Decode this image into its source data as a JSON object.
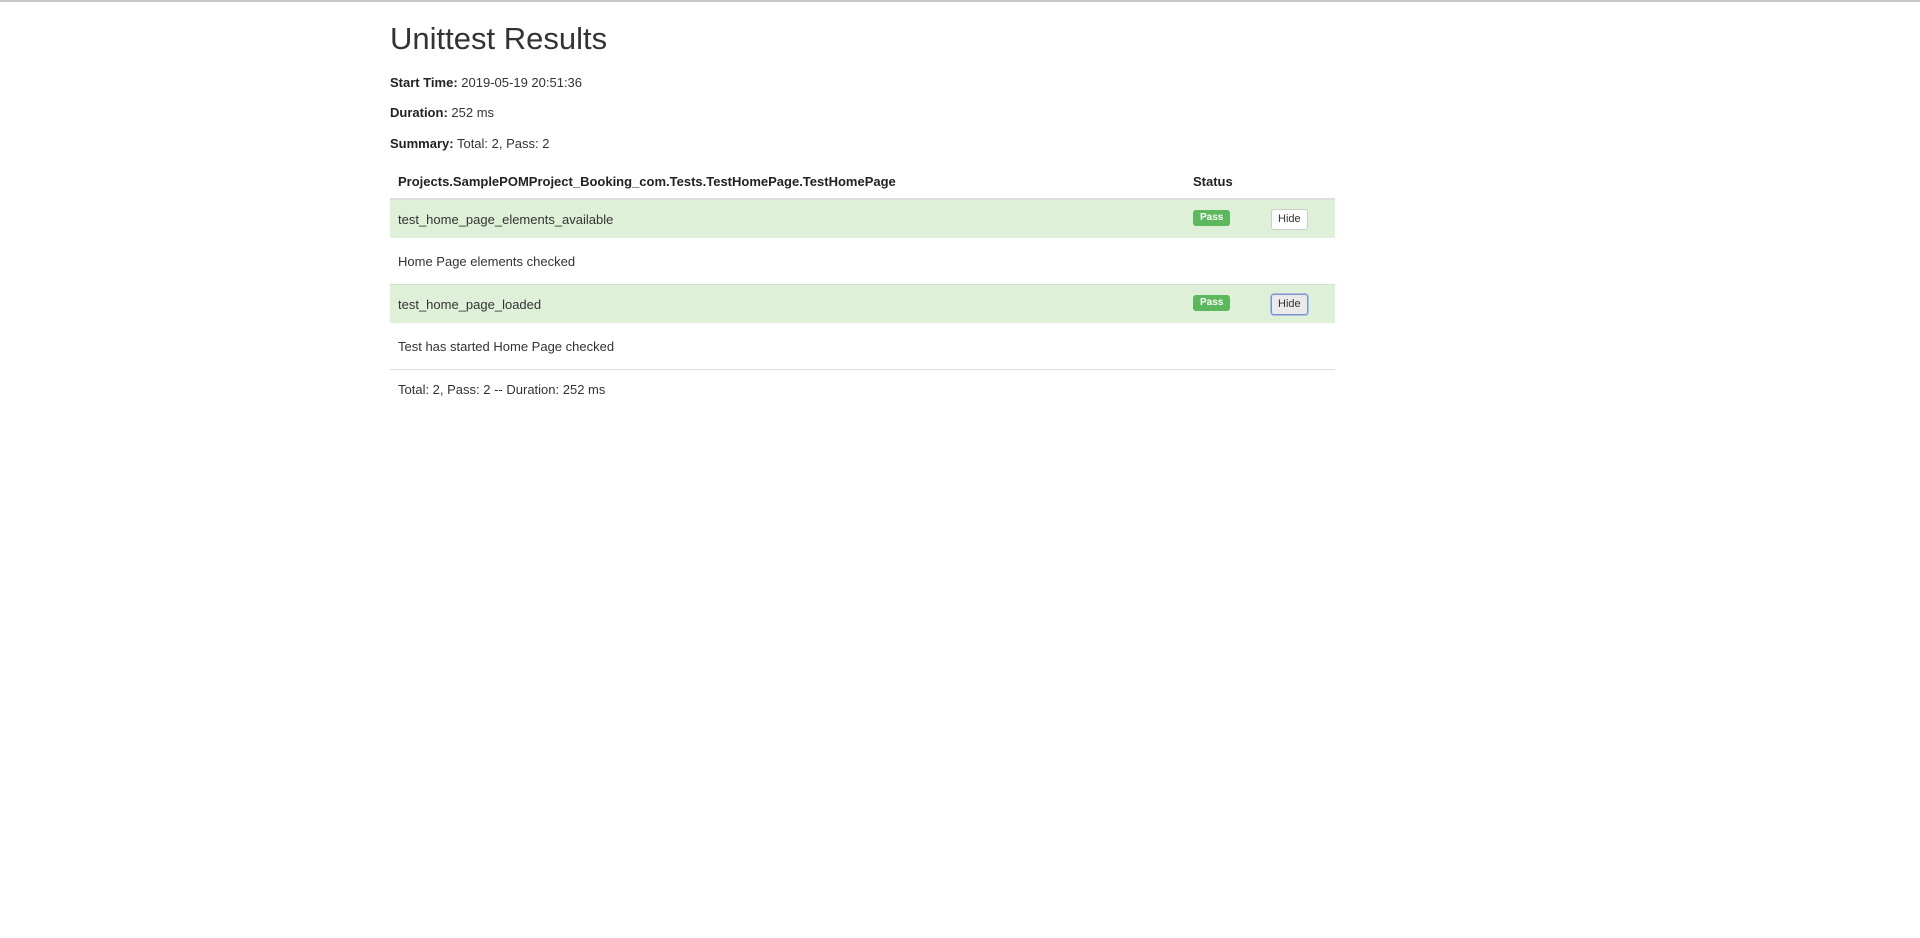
{
  "page": {
    "title": "Unittest Results"
  },
  "meta": {
    "start_time_label": "Start Time:",
    "start_time_value": "2019-05-19 20:51:36",
    "duration_label": "Duration:",
    "duration_value": "252 ms",
    "summary_label": "Summary:",
    "summary_value": "Total: 2, Pass: 2"
  },
  "table": {
    "header_name": "Projects.SamplePOMProject_Booking_com.Tests.TestHomePage.TestHomePage",
    "header_status": "Status",
    "rows": [
      {
        "test_name": "test_home_page_elements_available",
        "status": "Pass",
        "button_label": "Hide",
        "detail": "Home Page elements checked"
      },
      {
        "test_name": "test_home_page_loaded",
        "status": "Pass",
        "button_label": "Hide",
        "detail": "Test has started Home Page checked"
      }
    ],
    "footer": "Total: 2, Pass: 2 -- Duration: 252 ms"
  },
  "colors": {
    "pass_row_bg": "#dff0d8",
    "pass_badge": "#5cb85c"
  }
}
